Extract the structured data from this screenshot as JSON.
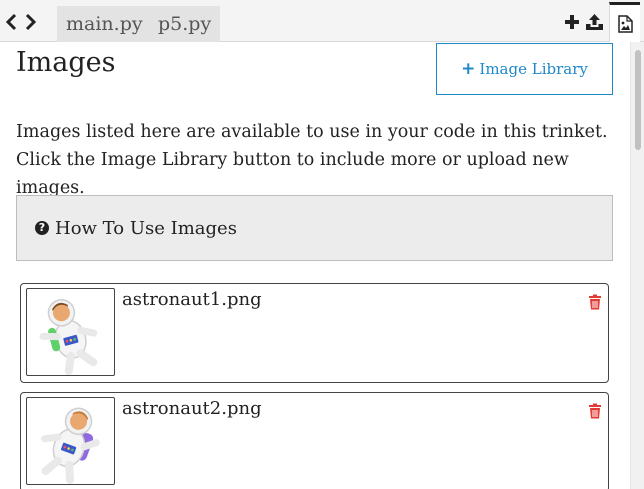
{
  "tabs": [
    {
      "label": "main.py"
    },
    {
      "label": "p5.py"
    }
  ],
  "page": {
    "title": "Images",
    "library_button": "Image Library",
    "description_line1": "Images listed here are available to use in your code in this trinket.",
    "description_line2": "Click the Image Library button to include more or upload new images.",
    "howto_label": "How To Use Images"
  },
  "images": [
    {
      "filename": "astronaut1.png"
    },
    {
      "filename": "astronaut2.png"
    }
  ],
  "icons": {
    "back": "chevron-left-icon",
    "forward": "chevron-right-icon",
    "add": "plus-icon",
    "upload": "upload-icon",
    "assets": "image-file-icon",
    "help": "question-circle-icon",
    "delete": "trash-icon"
  },
  "colors": {
    "accent": "#1e88c9",
    "delete": "#e53935",
    "panel": "#ececec"
  }
}
